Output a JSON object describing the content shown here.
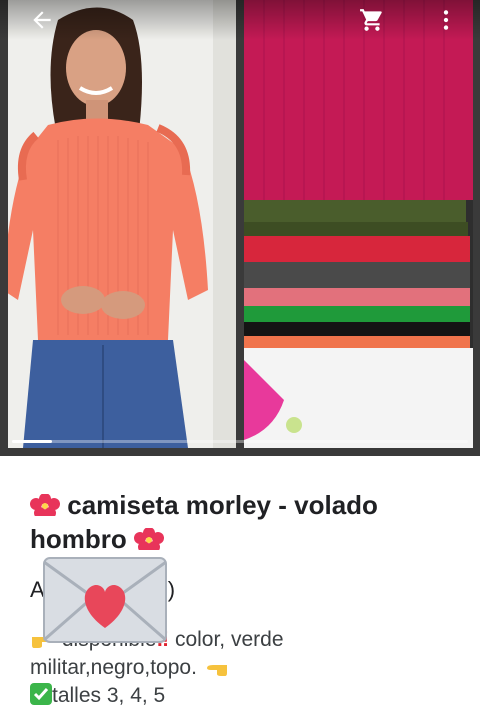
{
  "gallery": {
    "photo_count": 2,
    "current_index": 0
  },
  "icons": {
    "back": "arrow-back-icon",
    "cart": "shopping-cart-icon",
    "more": "more-vert-icon",
    "flower": "hibiscus-emoji-icon",
    "envelope": "love-letter-emoji-icon",
    "pointing": "backhand-index-pointing-right-emoji-icon",
    "alert": "double-exclamation-emoji-icon",
    "check": "check-mark-button-emoji-icon"
  },
  "product": {
    "title_part1": "camiseta morley - volado",
    "title_part2": "hombro",
    "price_prefix": "A",
    "price_suffix": ")",
    "desc_line1_word": "disponible",
    "desc_line1_rest": "color, verde",
    "desc_line2": "militar,negro,topo.",
    "desc_line3": "talles 3, 4, 5"
  },
  "colors": {
    "shirt_coral": "#f57e64",
    "folded_pink": "#d01f5a",
    "folded_olive": "#4a5d2c",
    "folded_red": "#d7263c",
    "folded_gray": "#4a4a4a",
    "folded_green": "#1f9a3a"
  }
}
